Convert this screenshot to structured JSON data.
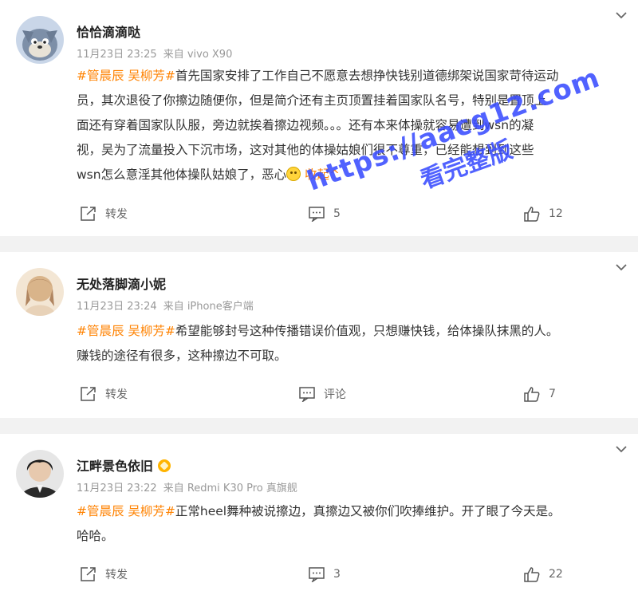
{
  "posts": [
    {
      "username": "恰恰滴滴哒",
      "time": "11月23日 23:25",
      "source": "来自 vivo X90",
      "tags": "#管晨辰 吴柳芳#",
      "text_lines": [
        "首先国家安排了工作自己不愿意去想挣快钱别道德绑架说国家苛待运动",
        "员，其次退役了你擦边随便你，但是简介还有主页顶置挂着国家队名号，特别是置顶上",
        "面还有穿着国家队队服，旁边就挨着擦边视频。。。还有本来体操就容易遭到wsn的凝",
        "视，吴为了流量投入下沉市场，这对其他的体操姑娘们很不尊重，已经能想到到这些",
        "wsn怎么意淫其他体操队姑娘了，恶心"
      ],
      "collapse_label": "收起",
      "repost_label": "转发",
      "comment_count": "5",
      "like_count": "12"
    },
    {
      "username": "无处落脚滴小妮",
      "time": "11月23日 23:24",
      "source": "来自 iPhone客户端",
      "tags": "#管晨辰 吴柳芳#",
      "text_lines": [
        "希望能够封号这种传播错误价值观，只想赚快钱，给体操队抹黑的人。",
        "赚钱的途径有很多，这种擦边不可取。"
      ],
      "repost_label": "转发",
      "comment_label": "评论",
      "like_count": "7"
    },
    {
      "username": "江畔景色依旧",
      "time": "11月23日 23:22",
      "source": "来自 Redmi K30 Pro 真旗舰",
      "tags": "#管晨辰 吴柳芳#",
      "text_lines": [
        "正常heel舞种被说擦边，真擦边又被你们吹捧维护。开了眼了今天是。",
        "哈哈。"
      ],
      "repost_label": "转发",
      "comment_count": "3",
      "like_count": "22"
    }
  ],
  "watermark": {
    "url": "https://aacg12.com",
    "subtitle": "看完整版"
  },
  "colors": {
    "tag": "#ff8200",
    "background": "#f2f2f2",
    "watermark": "#3a4dff"
  }
}
